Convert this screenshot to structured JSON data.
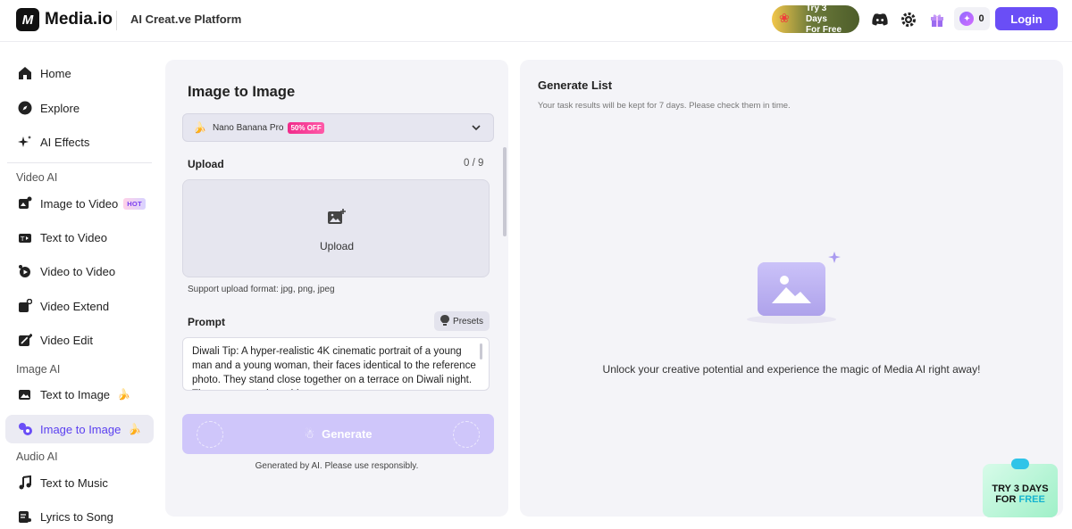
{
  "header": {
    "logo_mark": "M",
    "logo_text": "Media.io",
    "platform": "AI Creat.ve Platform",
    "trial_line1": "Try 3 Days",
    "trial_line2": "For Free",
    "credits": "0",
    "login": "Login"
  },
  "sidebar": {
    "items": [
      {
        "label": "Home",
        "icon": "home-icon"
      },
      {
        "label": "Explore",
        "icon": "compass-icon"
      },
      {
        "label": "AI Effects",
        "icon": "sparkle-icon"
      }
    ],
    "sections": {
      "video": "Video AI",
      "image": "Image AI",
      "audio": "Audio AI"
    },
    "video_items": [
      {
        "label": "Image to Video",
        "badge": "HOT"
      },
      {
        "label": "Text to Video"
      },
      {
        "label": "Video to Video"
      },
      {
        "label": "Video Extend"
      },
      {
        "label": "Video Edit"
      }
    ],
    "image_items": [
      {
        "label": "Text to Image"
      },
      {
        "label": "Image to Image"
      }
    ],
    "audio_items": [
      {
        "label": "Text to Music"
      },
      {
        "label": "Lyrics to Song"
      }
    ]
  },
  "left_panel": {
    "title": "Image to Image",
    "model": "Nano Banana Pro",
    "model_badge": "50% OFF",
    "upload_label": "Upload",
    "upload_count": "0 / 9",
    "upload_button": "Upload",
    "support": "Support upload format: jpg, png, jpeg",
    "prompt_label": "Prompt",
    "presets": "Presets",
    "prompt_text": "Diwali Tip: A hyper-realistic 4K cinematic portrait of a young man and a young woman, their faces identical to the reference photo. They stand close together on a terrace on Diwali night. The young man is on his ",
    "generate": "Generate",
    "disclaimer": "Generated by AI. Please use responsibly."
  },
  "right_panel": {
    "title": "Generate List",
    "subtitle": "Your task results will be kept for 7 days. Please check them in time.",
    "empty": "Unlock your creative potential and experience the magic of Media AI right away!"
  },
  "promo": {
    "line1": "TRY 3 DAYS",
    "line2_a": "FOR ",
    "line2_b": "FREE"
  },
  "colors": {
    "accent": "#6a4ef6",
    "panel_bg": "#f4f4f8",
    "generate_bg": "#cfc6fa"
  }
}
